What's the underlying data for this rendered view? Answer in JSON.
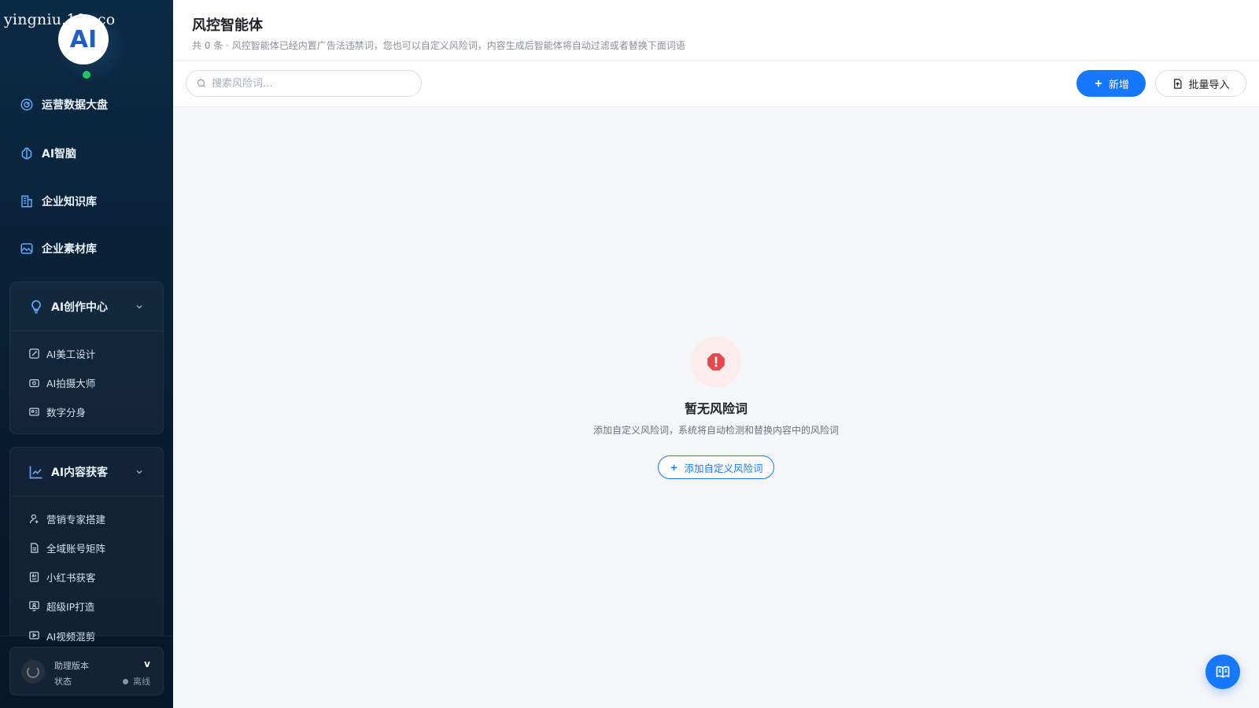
{
  "watermark": "yingniu.10v.co",
  "logo_text": "AI",
  "sidebar": {
    "items": [
      {
        "label": "运营数据大盘",
        "icon": "dashboard-icon"
      },
      {
        "label": "AI智脑",
        "icon": "brain-icon"
      },
      {
        "label": "企业知识库",
        "icon": "building-icon"
      },
      {
        "label": "企业素材库",
        "icon": "image-icon"
      }
    ],
    "groups": [
      {
        "title": "AI创作中心",
        "icon": "lightbulb-gear-icon",
        "items": [
          {
            "label": "AI美工设计",
            "icon": "palette-icon"
          },
          {
            "label": "AI拍摄大师",
            "icon": "camera-icon"
          },
          {
            "label": "数字分身",
            "icon": "id-card-icon"
          }
        ]
      },
      {
        "title": "AI内容获客",
        "icon": "trend-chart-icon",
        "items": [
          {
            "label": "营销专家搭建",
            "icon": "user-icon"
          },
          {
            "label": "全域账号矩阵",
            "icon": "file-icon"
          },
          {
            "label": "小红书获客",
            "icon": "ai-box-icon"
          },
          {
            "label": "超级IP打造",
            "icon": "monitor-user-icon"
          },
          {
            "label": "AI视频混剪",
            "icon": "video-icon"
          }
        ]
      }
    ],
    "status": {
      "version_label": "助理版本",
      "version_value": "v",
      "state_label": "状态",
      "state_value": "离线"
    }
  },
  "header": {
    "title": "风控智能体",
    "subtitle": "共 0 条 · 风控智能体已经内置广告法违禁词，您也可以自定义风险词，内容生成后智能体将自动过滤或者替换下面词语"
  },
  "toolbar": {
    "search_placeholder": "搜索风险词...",
    "add_label": "新增",
    "import_label": "批量导入"
  },
  "empty": {
    "title": "暂无风险词",
    "desc": "添加自定义风险词，系统将自动检测和替换内容中的风险词",
    "button": "添加自定义风险词"
  },
  "colors": {
    "primary": "#1677ff",
    "danger": "#e5484d",
    "sidebar_bg": "#0a2238",
    "online": "#22c55e"
  }
}
